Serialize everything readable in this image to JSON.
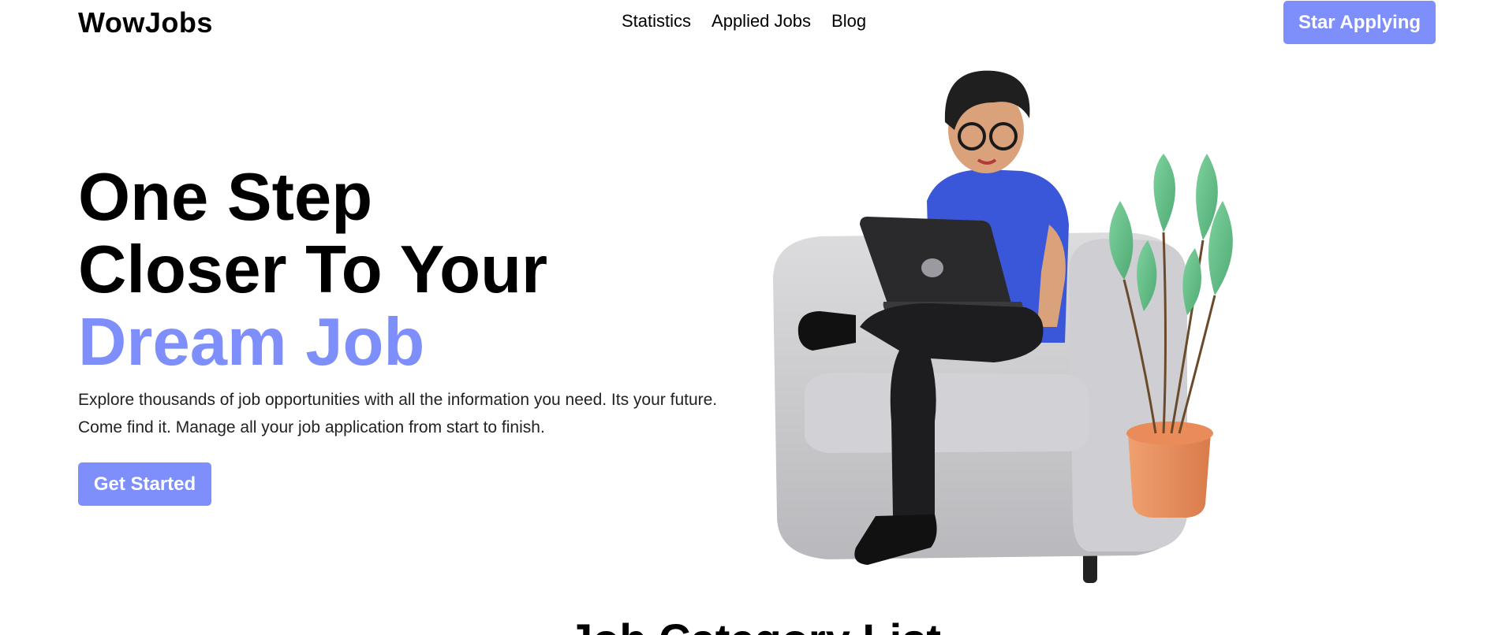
{
  "header": {
    "brand": "WowJobs",
    "nav": [
      "Statistics",
      "Applied Jobs",
      "Blog"
    ],
    "cta_label": "Star Applying"
  },
  "hero": {
    "title_line1": "One Step",
    "title_line2": "Closer To Your",
    "title_accent": "Dream Job",
    "description": "Explore thousands of job opportunities with all the information you need. Its your future. Come find it. Manage all your job application from start to finish.",
    "cta_label": "Get Started"
  },
  "section": {
    "title": "Job Category List"
  },
  "colors": {
    "accent": "#7e8ffb"
  }
}
